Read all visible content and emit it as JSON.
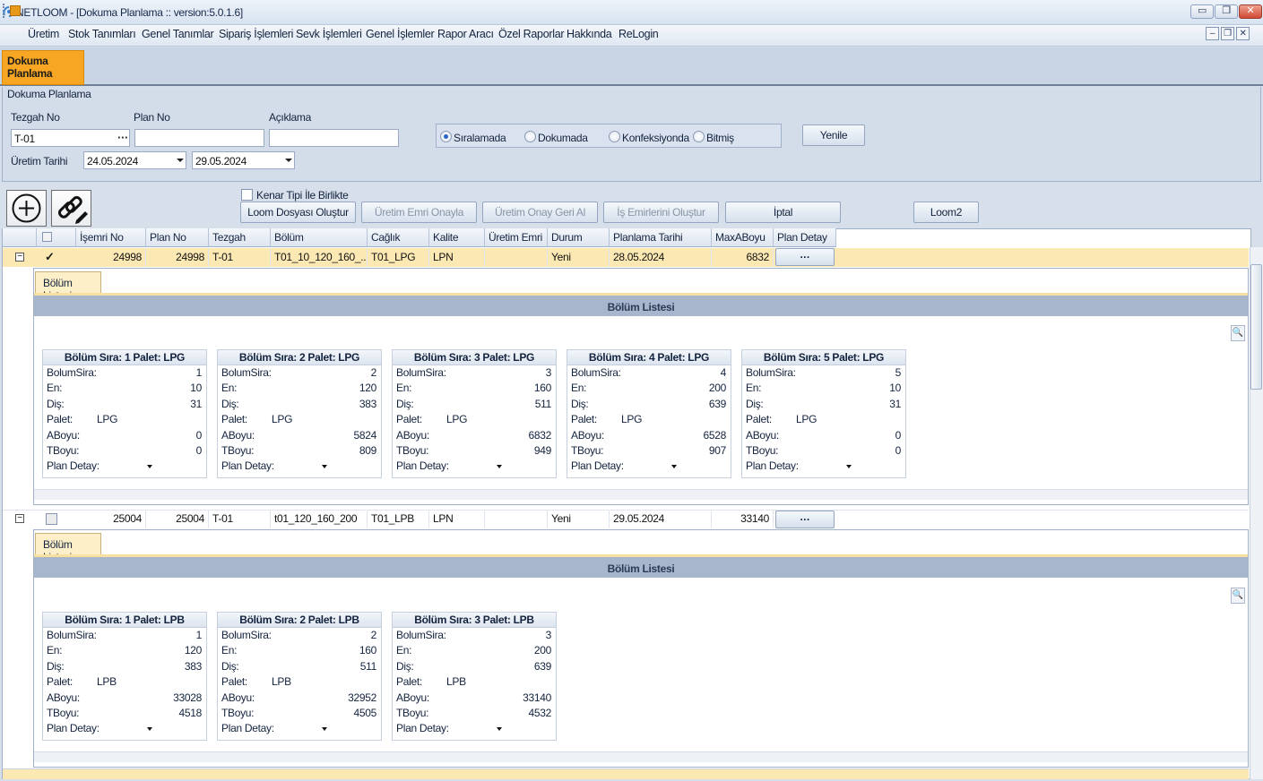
{
  "window": {
    "title": "NETLOOM - [Dokuma Planlama :: version:5.0.1.6]",
    "min_glyph": "▭",
    "restore_glyph": "❐",
    "close_glyph": "✕"
  },
  "menu": {
    "items": [
      "Üretim",
      "Stok Tanımları",
      "Genel Tanımlar",
      "Sipariş İşlemleri",
      "Sevk İşlemleri",
      "Genel İşlemler",
      "Rapor Aracı",
      "Özel Raporlar",
      "Hakkında",
      "ReLogin"
    ],
    "mdi_min": "–",
    "mdi_restore": "❐",
    "mdi_close": "✕"
  },
  "tab": {
    "label_line1": "Dokuma",
    "label_line2": "Planlama"
  },
  "filter": {
    "title": "Dokuma Planlama",
    "tezgah_label": "Tezgah No",
    "tezgah_value": "T-01",
    "dots": "···",
    "plan_label": "Plan No",
    "plan_value": "",
    "aciklama_label": "Açıklama",
    "aciklama_value": "",
    "uretim_label": "Üretim Tarihi",
    "date_from": "24.05.2024",
    "date_to": "29.05.2024",
    "radios": [
      {
        "label": "Sıralamada",
        "selected": true
      },
      {
        "label": "Dokumada",
        "selected": false
      },
      {
        "label": "Konfeksiyonda",
        "selected": false
      },
      {
        "label": "Bitmiş",
        "selected": false
      }
    ],
    "refresh": "Yenile"
  },
  "toolbar": {
    "kenar_label": "Kenar Tipi İle Birlikte",
    "buttons": [
      {
        "label": "Loom Dosyası Oluştur",
        "enabled": true
      },
      {
        "label": "Üretim Emri Onayla",
        "enabled": false
      },
      {
        "label": "Üretim Onay Geri Al",
        "enabled": false
      },
      {
        "label": "İş Emirlerini Oluştur",
        "enabled": false
      },
      {
        "label": "İptal",
        "enabled": true
      }
    ],
    "loom2": "Loom2",
    "add_icon": "add-circle-icon",
    "link_icon": "link-edit-icon"
  },
  "grid": {
    "columns": [
      "İşemri No",
      "Plan No",
      "Tezgah",
      "Bölüm",
      "Cağlık",
      "Kalite",
      "Üretim Emri",
      "Durum",
      "Planlama Tarihi",
      "MaxABoyu",
      "Plan Detay"
    ],
    "rows": [
      {
        "isemri": "24998",
        "plan": "24998",
        "tezgah": "T-01",
        "bolum": "T01_10_120_160_...",
        "caglik": "T01_LPG",
        "kalite": "LPN",
        "uretim": "",
        "durum": "Yeni",
        "tarih": "28.05.2024",
        "max": "6832",
        "detay": "···",
        "checked": true,
        "detail": {
          "tab": "Bölüm Listesi",
          "header": "Bölüm Listesi",
          "cards": [
            {
              "title": "Bölüm Sıra: 1 Palet: LPG",
              "bolum": "1",
              "en": "10",
              "dis": "31",
              "palet": "LPG",
              "aboyu": "0",
              "tboyu": "0"
            },
            {
              "title": "Bölüm Sıra: 2 Palet: LPG",
              "bolum": "2",
              "en": "120",
              "dis": "383",
              "palet": "LPG",
              "aboyu": "5824",
              "tboyu": "809"
            },
            {
              "title": "Bölüm Sıra: 3 Palet: LPG",
              "bolum": "3",
              "en": "160",
              "dis": "511",
              "palet": "LPG",
              "aboyu": "6832",
              "tboyu": "949"
            },
            {
              "title": "Bölüm Sıra: 4 Palet: LPG",
              "bolum": "4",
              "en": "200",
              "dis": "639",
              "palet": "LPG",
              "aboyu": "6528",
              "tboyu": "907"
            },
            {
              "title": "Bölüm Sıra: 5 Palet: LPG",
              "bolum": "5",
              "en": "10",
              "dis": "31",
              "palet": "LPG",
              "aboyu": "0",
              "tboyu": "0"
            }
          ]
        }
      },
      {
        "isemri": "25004",
        "plan": "25004",
        "tezgah": "T-01",
        "bolum": "t01_120_160_200",
        "caglik": "T01_LPB",
        "kalite": "LPN",
        "uretim": "",
        "durum": "Yeni",
        "tarih": "29.05.2024",
        "max": "33140",
        "detay": "···",
        "checked": false,
        "detail": {
          "tab": "Bölüm Listesi",
          "header": "Bölüm Listesi",
          "cards": [
            {
              "title": "Bölüm Sıra: 1 Palet: LPB",
              "bolum": "1",
              "en": "120",
              "dis": "383",
              "palet": "LPB",
              "aboyu": "33028",
              "tboyu": "4518"
            },
            {
              "title": "Bölüm Sıra: 2 Palet: LPB",
              "bolum": "2",
              "en": "160",
              "dis": "511",
              "palet": "LPB",
              "aboyu": "32952",
              "tboyu": "4505"
            },
            {
              "title": "Bölüm Sıra: 3 Palet: LPB",
              "bolum": "3",
              "en": "200",
              "dis": "639",
              "palet": "LPB",
              "aboyu": "33140",
              "tboyu": "4532"
            }
          ]
        }
      }
    ],
    "card_labels": {
      "bolum": "BolumSira:",
      "en": "En:",
      "dis": "Diş:",
      "palet": "Palet:",
      "aboyu": "ABoyu:",
      "tboyu": "TBoyu:",
      "plan": "Plan Detay:"
    },
    "expand_glyph": "−",
    "check_glyph": "✓",
    "zoom_glyph": "🔍"
  }
}
